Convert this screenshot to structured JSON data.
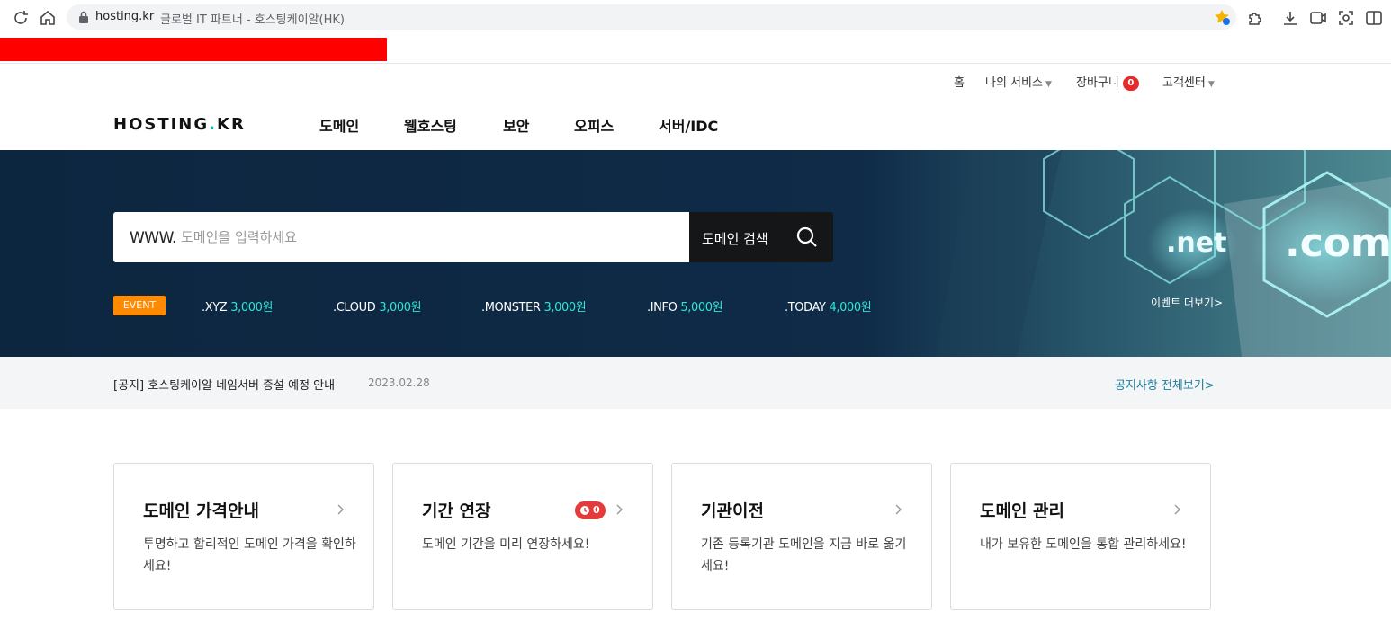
{
  "browser": {
    "url": "hosting.kr",
    "title": "글로벌 IT 파트너 - 호스팅케이알(HK)"
  },
  "util_nav": {
    "home": "홈",
    "my_services": "나의 서비스",
    "cart": "장바구니",
    "cart_count": "0",
    "support": "고객센터"
  },
  "logo": {
    "text_a": "HOSTING",
    "text_dot": ".",
    "text_b": "KR"
  },
  "gnb": [
    "도메인",
    "웹호스팅",
    "보안",
    "오피스",
    "서버/IDC"
  ],
  "search": {
    "prefix": "WWW.",
    "placeholder": "도메인을 입력하세요",
    "button": "도메인 검색"
  },
  "event": {
    "badge": "EVENT",
    "items": [
      {
        "ext": ".XYZ",
        "price": "3,000원"
      },
      {
        "ext": ".CLOUD",
        "price": "3,000원"
      },
      {
        "ext": ".MONSTER",
        "price": "3,000원"
      },
      {
        "ext": ".INFO",
        "price": "5,000원"
      },
      {
        "ext": ".TODAY",
        "price": "4,000원"
      }
    ],
    "more": "이벤트 더보기>",
    "visual_net": ".net",
    "visual_com": ".com"
  },
  "notice": {
    "text": "[공지] 호스팅케이알 네임서버 증설 예정 안내",
    "date": "2023.02.28",
    "more": "공지사항 전체보기>"
  },
  "cards": [
    {
      "title": "도메인 가격안내",
      "desc": "투명하고 합리적인 도메인 가격을 확인하세요!"
    },
    {
      "title": "기간 연장",
      "desc": "도메인 기간을 미리 연장하세요!",
      "badge": "0"
    },
    {
      "title": "기관이전",
      "desc": "기존 등록기관 도메인을 지금 바로 옮기세요!"
    },
    {
      "title": "도메인 관리",
      "desc": "내가 보유한 도메인을 통합 관리하세요!"
    }
  ],
  "colors": {
    "accent_teal": "#2ee6d8",
    "event_orange": "#ff8a00",
    "hero_navy": "#0d2640",
    "badge_red": "#e53a3a"
  }
}
